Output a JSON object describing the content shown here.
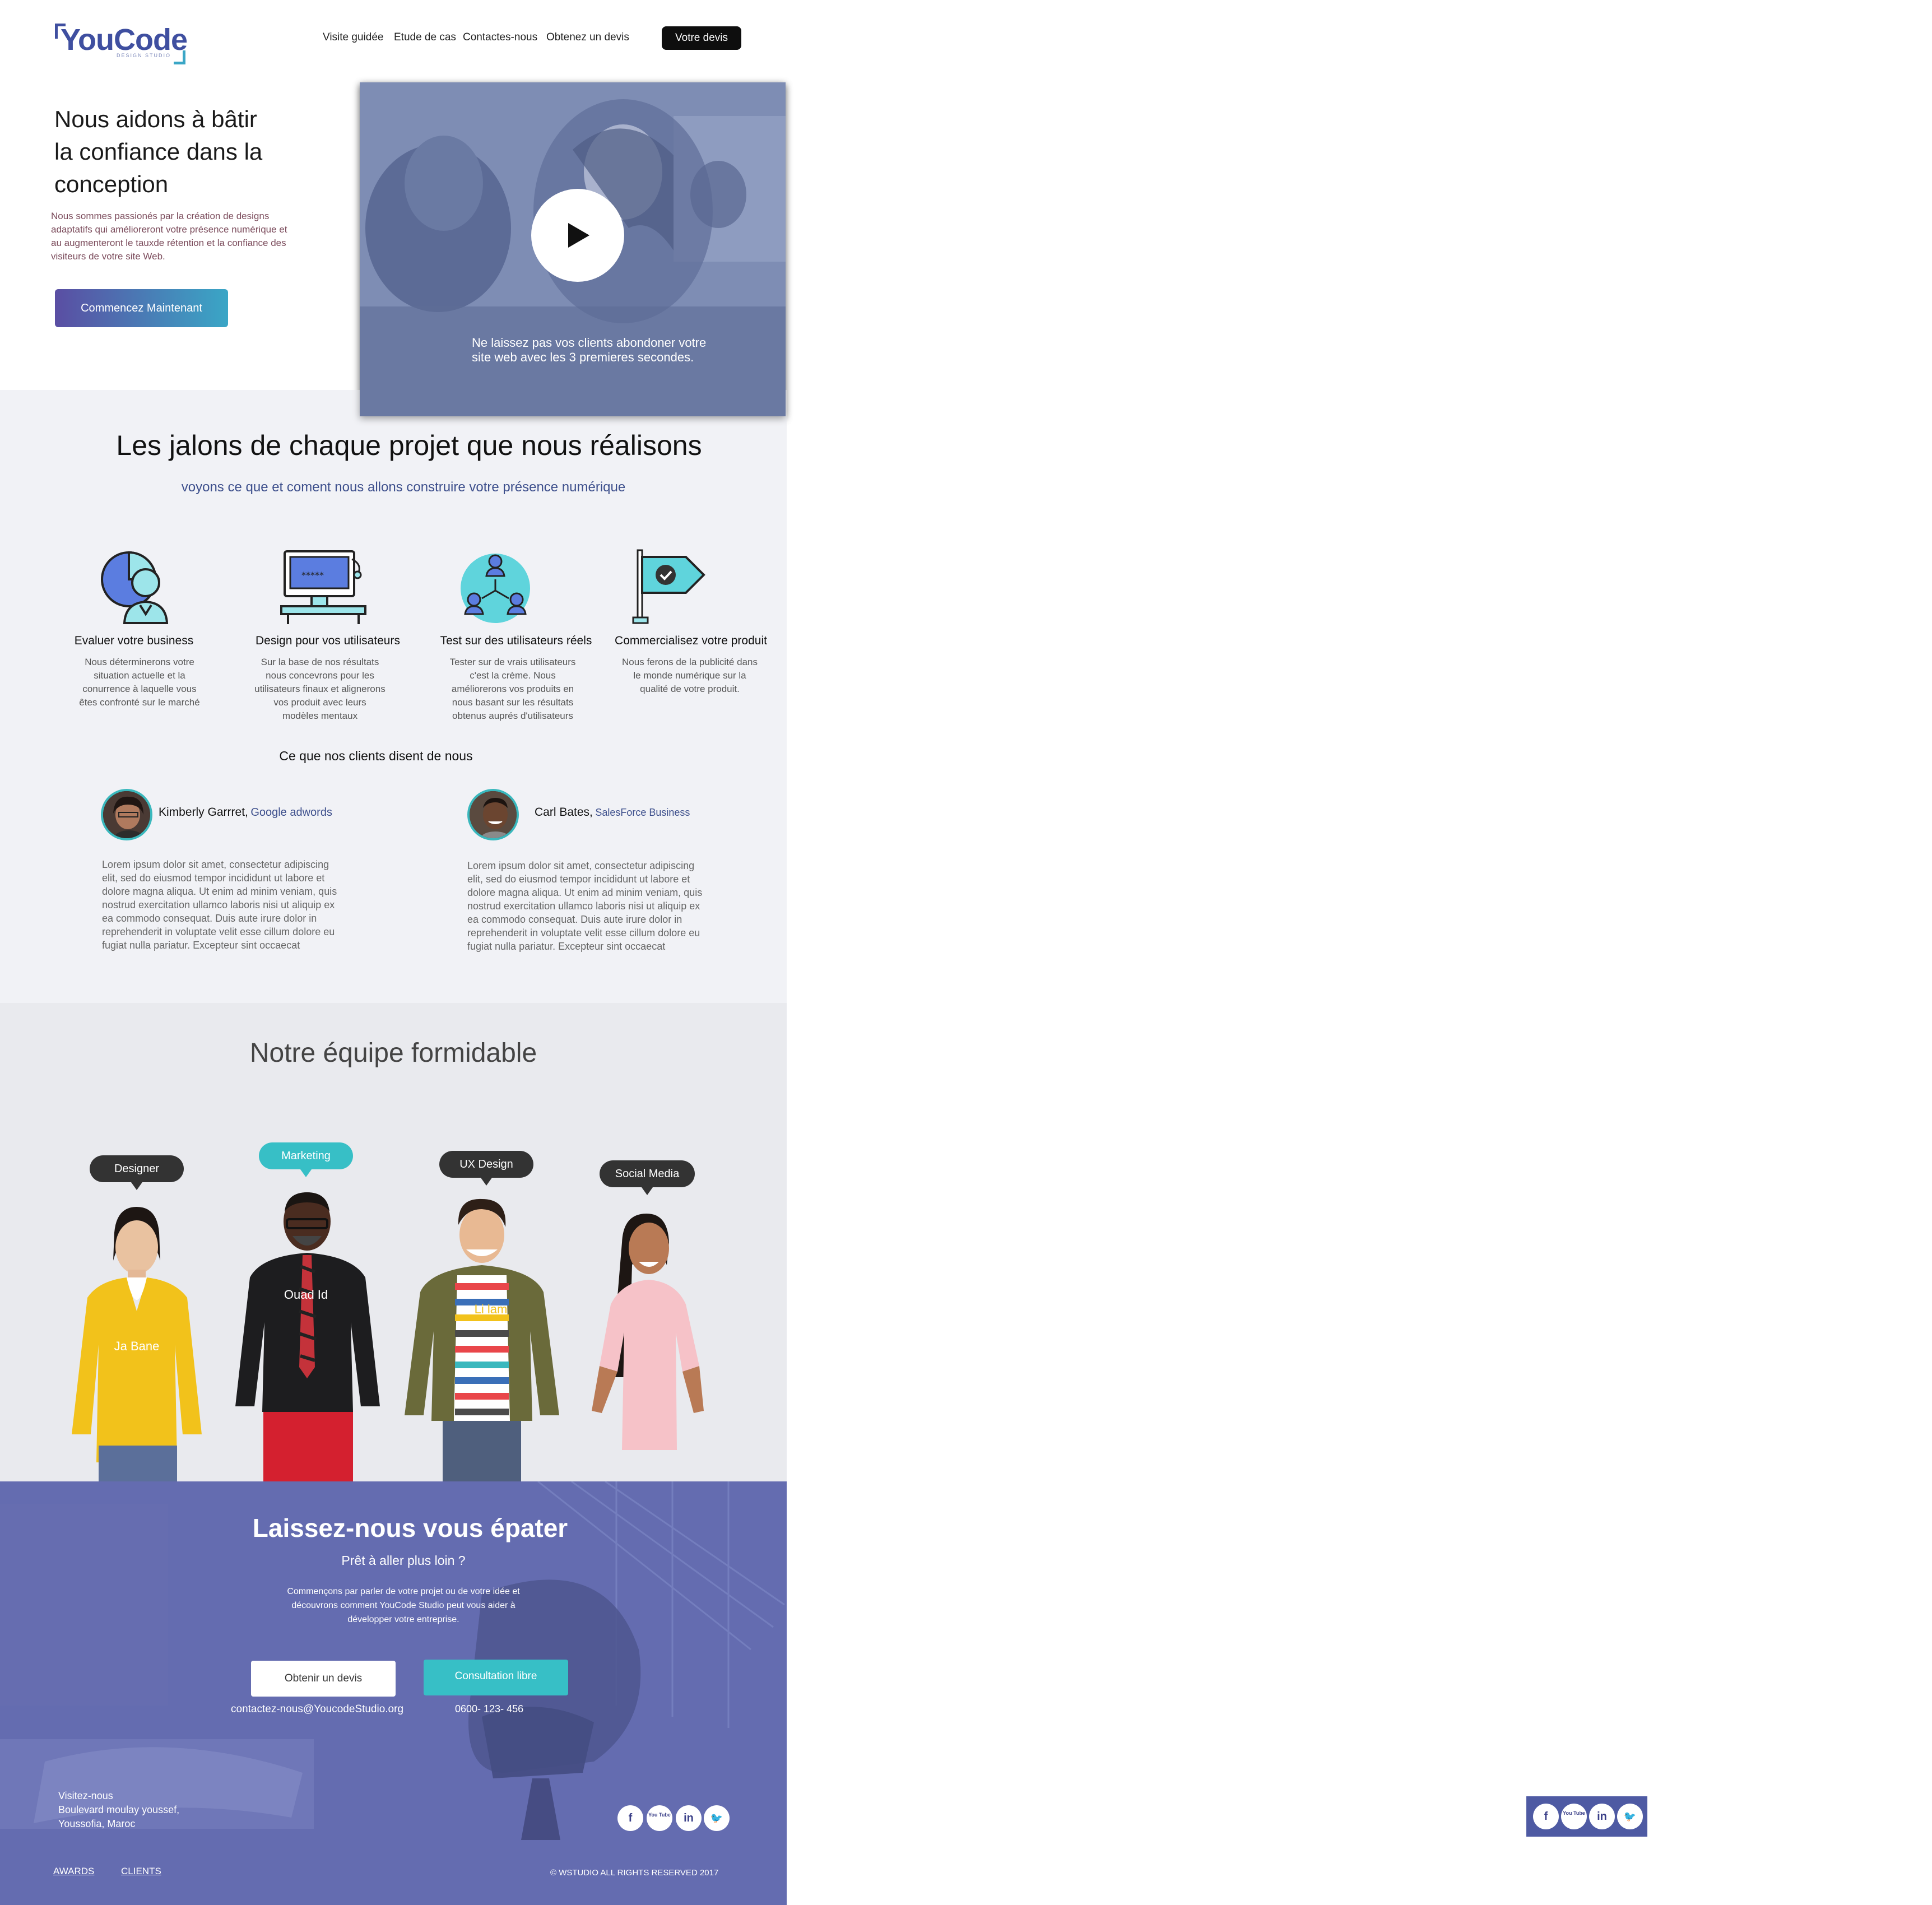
{
  "header": {
    "logo": "YouCode",
    "logo_tagline": "DESIGN STUDIO",
    "nav": [
      "Visite guidée",
      "Etude de cas",
      "Contactes-nous",
      "Obtenez un devis"
    ],
    "cta": "Votre devis"
  },
  "hero": {
    "title_lines": [
      "Nous aidons à bâtir",
      "la confiance dans la",
      "conception"
    ],
    "description_lines": [
      "Nous sommes passionés par la création de designs",
      "adaptatifs qui amélioreront votre présence numérique et",
      "au augmenteront le tauxde rétention et la confiance des",
      "visiteurs de votre site Web."
    ],
    "button": "Commencez Maintenant",
    "video_caption_lines": [
      "Ne laissez pas vos clients abondoner votre",
      "site web avec les 3 premieres secondes."
    ],
    "video_icon": "play-icon"
  },
  "milestones": {
    "title": "Les jalons de chaque projet que nous réalisons",
    "subtitle": "voyons ce que et coment nous allons construire votre présence numérique",
    "features": [
      {
        "icon": "analytics-person-icon",
        "title": "Evaluer votre business",
        "desc": [
          "Nous déterminerons votre",
          "situation actuelle et la",
          "conurrence à laquelle vous",
          "êtes confronté sur le marché"
        ]
      },
      {
        "icon": "desktop-workstation-icon",
        "title": "Design pour vos utilisateurs",
        "desc": [
          "Sur la base de nos résultats",
          "nous concevrons pour les",
          "utilisateurs finaux et alignerons",
          "vos produit avec leurs",
          "modèles mentaux"
        ]
      },
      {
        "icon": "user-network-icon",
        "title": "Test sur des utilisateurs réels",
        "desc": [
          "Tester sur de vrais utilisateurs",
          "c'est la crème. Nous",
          "améliorerons vos produits en",
          "nous basant sur les résultats",
          "obtenus auprés d'utilisateurs"
        ]
      },
      {
        "icon": "flag-check-icon",
        "title": "Commercialisez votre produit",
        "desc": [
          "Nous ferons de la publicité dans",
          "le monde numérique sur la",
          "qualité de votre produit."
        ]
      }
    ]
  },
  "testimonials": {
    "heading": "Ce que nos clients disent de nous",
    "items": [
      {
        "name": "Kimberly Garrret,",
        "company": "Google adwords",
        "body": [
          "Lorem ipsum dolor sit amet, consectetur adipiscing",
          "elit, sed do eiusmod tempor incididunt ut labore et",
          "dolore magna aliqua. Ut enim ad minim veniam, quis",
          "nostrud exercitation ullamco laboris nisi ut aliquip ex",
          "ea commodo consequat. Duis aute irure dolor in",
          "reprehenderit in voluptate velit esse cillum dolore eu",
          "fugiat nulla pariatur. Excepteur sint occaecat"
        ]
      },
      {
        "name": "Carl Bates,",
        "company": "SalesForce Business",
        "body": [
          "Lorem ipsum dolor sit amet, consectetur adipiscing",
          "elit, sed do eiusmod tempor incididunt ut labore et",
          "dolore magna aliqua. Ut enim ad minim veniam, quis",
          "nostrud exercitation ullamco laboris nisi ut aliquip ex",
          "ea commodo consequat. Duis aute irure dolor in",
          "reprehenderit in voluptate velit esse cillum dolore eu",
          "fugiat nulla pariatur. Excepteur sint occaecat"
        ]
      }
    ]
  },
  "team": {
    "title": "Notre équipe formidable",
    "members": [
      {
        "role": "Designer",
        "name": "Ja Bane",
        "shirt": "#f2c21b"
      },
      {
        "role": "Marketing",
        "name": "Ouad Id",
        "shirt": "#1d1d1f"
      },
      {
        "role": "UX Design",
        "name": "Li lam",
        "shirt": "#6a6a3a"
      },
      {
        "role": "Social Media",
        "name": "",
        "shirt": "#f6c2c8"
      }
    ]
  },
  "cta_footer": {
    "title": "Laissez-nous vous épater",
    "subtitle": "Prêt à aller plus loin ?",
    "desc": [
      "Commençons par parler de votre projet ou de votre idée et",
      "découvrons comment YouCode Studio peut vous aider à",
      "développer votre entreprise."
    ],
    "btn_quote": "Obtenir un devis",
    "btn_consult": "Consultation libre",
    "email": "contactez-nous@YoucodeStudio.org",
    "phone": "0600- 123- 456",
    "address": [
      "Visitez-nous",
      "Boulevard moulay youssef,",
      "Youssofia, Maroc"
    ],
    "social": [
      {
        "icon": "facebook-icon",
        "glyph": "f"
      },
      {
        "icon": "youtube-icon",
        "glyph": "You Tube"
      },
      {
        "icon": "linkedin-icon",
        "glyph": "in"
      },
      {
        "icon": "twitter-icon",
        "glyph": "🐦"
      }
    ],
    "links": [
      "AWARDS",
      "CLIENTS"
    ],
    "copyright": "© WSTUDIO ALL RIGHTS RESERVED 2017"
  },
  "colors": {
    "accent": "#3d4f8c",
    "teal": "#37bfc6",
    "footer_overlay": "#5e66ab"
  }
}
